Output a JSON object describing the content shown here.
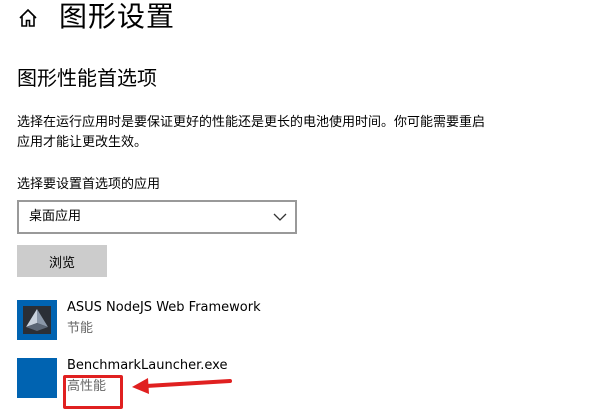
{
  "header": {
    "home_icon": "home-icon",
    "title": "图形设置"
  },
  "section": {
    "title": "图形性能首选项",
    "description": "选择在运行应用时是要保证更好的性能还是更长的电池使用时间。你可能需要重启应用才能让更改生效。"
  },
  "app_selector": {
    "label": "选择要设置首选项的应用",
    "dropdown_value": "桌面应用",
    "dropdown_icon": "chevron-down-icon",
    "browse_label": "浏览"
  },
  "apps": [
    {
      "name": "ASUS NodeJS Web Framework",
      "preference": "节能",
      "icon": "asus-app-icon"
    },
    {
      "name": "BenchmarkLauncher.exe",
      "preference": "高性能",
      "icon": "benchmark-app-icon"
    }
  ],
  "colors": {
    "highlight": "#e02020",
    "app_icon_blue": "#0063b1",
    "button_gray": "#cccccc",
    "secondary_text": "#666666"
  }
}
